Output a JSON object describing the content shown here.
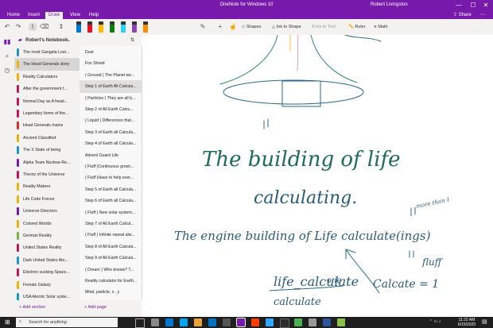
{
  "window": {
    "title": "OneNote for Windows 10",
    "user": "Robert Livingston",
    "minimize": "—",
    "maximize": "☐",
    "close": "✕"
  },
  "menu": {
    "tabs": [
      "Home",
      "Insert",
      "Draw",
      "View",
      "Help"
    ],
    "active": "Draw",
    "share": "Share"
  },
  "ribbon": {
    "shapes": "Shapes",
    "ink_to_shape": "Ink to Shape",
    "ink_to_text": "Ink to Text",
    "ruler": "Ruler",
    "math": "Math",
    "pen_colors": [
      "#0078d4",
      "#e81123",
      "#ffb900",
      "#107c10",
      "#2bd2f5",
      "#8e44ad",
      "#ff8c00"
    ]
  },
  "notebook": {
    "name": "Robert's Notebook"
  },
  "sections": [
    {
      "label": "The most Gangsta Lost...",
      "color": "#2196c9"
    },
    {
      "label": "The Head Generals story",
      "color": "#e7b416"
    },
    {
      "label": "Reality Calculators",
      "color": "#e7b416"
    },
    {
      "label": "After the government f...",
      "color": "#c2185b"
    },
    {
      "label": "Normal Day as A head...",
      "color": "#c2185b"
    },
    {
      "label": "Legendary Items of the...",
      "color": "#c2185b"
    },
    {
      "label": "Head Generals mains",
      "color": "#d32f2f"
    },
    {
      "label": "Ancient Classified",
      "color": "#e7b416"
    },
    {
      "label": "The X State of being",
      "color": "#2196c9"
    },
    {
      "label": "Alpha Team Nuclear-Re...",
      "color": "#7719aa"
    },
    {
      "label": "Theory of the Universe",
      "color": "#c2185b"
    },
    {
      "label": "Reality Makers",
      "color": "#e7b416"
    },
    {
      "label": "Life Code Forces",
      "color": "#e7b416"
    },
    {
      "label": "Universe Directors",
      "color": "#7719aa"
    },
    {
      "label": "Colored Worlds",
      "color": "#e7b416"
    },
    {
      "label": "German Reality",
      "color": "#7cb342"
    },
    {
      "label": "United States Reality",
      "color": "#c2185b"
    },
    {
      "label": "Dark United States Ato...",
      "color": "#2196c9"
    },
    {
      "label": "Electron sucking Space...",
      "color": "#c2185b"
    },
    {
      "label": "Female Galaxy",
      "color": "#e7b416"
    },
    {
      "label": "USA Atomic Solar syste...",
      "color": "#2196c9"
    }
  ],
  "pages": [
    "Dust",
    "Fox Shield",
    "( Ground ) The Planet we...",
    "Step 1 of Earth All Calcula...",
    "( Particles ) They are all b...",
    "Step 2 of All Earth Calcu...",
    "( Liquid ) Differences that...",
    "Step 3 of Earth all Calcula...",
    "Step 4 of Earth all Calcula...",
    "Advent Guard Life",
    "( Fluff )Continuous growt...",
    "( Fluff )Have to help ever...",
    "Step 5 of Earth all Calcula...",
    "Step 6 of Earth all Calcula...",
    "( Fluff ) New solar system...",
    "Step 7 of All Earth Calcul...",
    "( Fluff ) Infinite repeat alw...",
    "Step 8 of All Earth Calcula...",
    "Step 9 of All Earth Calcula...",
    "( Dream ) Who knows? T...",
    "Reality calculator for Earth...",
    "Mind, particle, x , y"
  ],
  "active_page_index": 3,
  "footer": {
    "add_section": "Add section",
    "add_page": "Add page"
  },
  "ink": {
    "line1": "The building of life",
    "line2": "calculating.",
    "line3": "The engine building of Life calculate(ings)",
    "note_more": "more than 1",
    "note_fluff": "fluff",
    "life_calc": "life_calculate",
    "one": "one",
    "calculate": "calculate",
    "calcate_eq": "Calcate = 1"
  },
  "taskbar": {
    "search": "Search for anything",
    "time": "11:22 AM",
    "date": "6/15/2020"
  }
}
